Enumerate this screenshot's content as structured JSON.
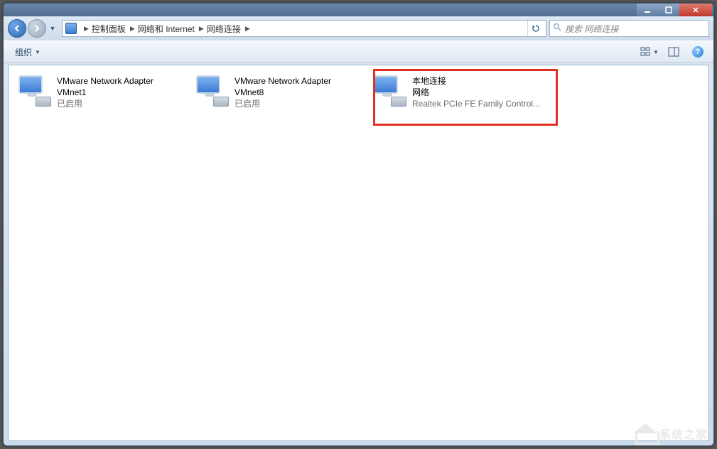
{
  "titlebar": {
    "min_tooltip": "最小化",
    "max_tooltip": "最大化",
    "close_tooltip": "关闭"
  },
  "nav": {
    "back_tooltip": "后退",
    "forward_tooltip": "前进"
  },
  "breadcrumbs": {
    "item0": "控制面板",
    "item1": "网络和 Internet",
    "item2": "网络连接"
  },
  "search": {
    "placeholder": "搜索 网络连接"
  },
  "toolbar": {
    "organize": "组织"
  },
  "items": [
    {
      "line1": "VMware Network Adapter",
      "line2": "VMnet1",
      "line3": "已启用"
    },
    {
      "line1": "VMware Network Adapter",
      "line2": "VMnet8",
      "line3": "已启用"
    },
    {
      "line1": "本地连接",
      "line2": "网络",
      "line3": "Realtek PCIe FE Family Control..."
    }
  ],
  "watermark": {
    "text": "系统之家"
  }
}
